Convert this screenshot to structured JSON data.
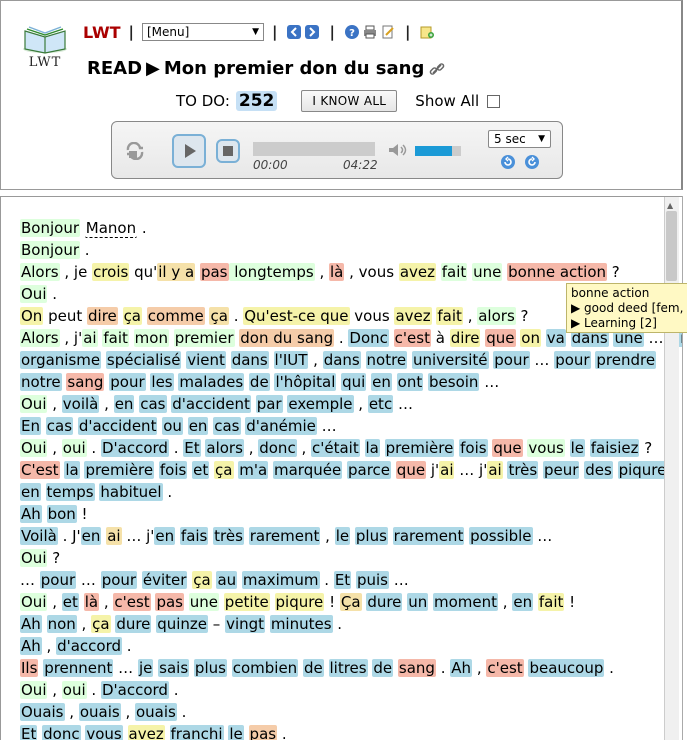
{
  "header": {
    "logo_text": "LWT",
    "brand": "LWT",
    "menu_select": "[Menu]",
    "read_label": "READ",
    "arrow": "▶",
    "title": "Mon premier don du sang",
    "todo_label": "TO DO:",
    "todo_count": "252",
    "know_all_label": "I KNOW ALL",
    "show_all_label": "Show All",
    "icons": [
      "prev-text-icon",
      "next-text-icon",
      "help-icon",
      "print-icon",
      "edit-text-icon",
      "new-term-icon",
      "link-icon"
    ]
  },
  "player": {
    "time_current": "00:00",
    "time_total": "04:22",
    "skip_select": "5 sec",
    "volume_level": 0.8,
    "progress_level": 0
  },
  "tooltip": {
    "line1": "bonne action",
    "line2": "▶ good deed [fem,",
    "line3": "▶ Learning [2]"
  },
  "colors": {
    "status1": "#f5b8a9",
    "status2": "#f5cca9",
    "status3": "#f5e1a9",
    "status4": "#f5f3a9",
    "status5": "#ddffdd",
    "unknown": "#add8e6",
    "brand": "#aa0000"
  },
  "text": {
    "lines": [
      [
        [
          "Bonjour",
          "s5"
        ],
        [
          " "
        ],
        [
          "Manon",
          "ign"
        ],
        [
          " ."
        ]
      ],
      [
        [
          "Bonjour",
          "s5"
        ],
        [
          " ."
        ]
      ],
      [
        [
          "Alors",
          "s5"
        ],
        [
          " , je "
        ],
        [
          "crois",
          "s4"
        ],
        [
          " qu'"
        ],
        [
          "il y a",
          "s3"
        ],
        [
          " "
        ],
        [
          "pas",
          "s1"
        ],
        [
          " longtemps",
          "s5"
        ],
        [
          " , "
        ],
        [
          "là",
          "s1"
        ],
        [
          " , vous "
        ],
        [
          "avez",
          "s4"
        ],
        [
          " "
        ],
        [
          "fait",
          "s5"
        ],
        [
          " "
        ],
        [
          "une",
          "s5"
        ],
        [
          " "
        ],
        [
          "bonne action",
          "s1"
        ],
        [
          " ?"
        ]
      ],
      [
        [
          "Oui",
          "s5"
        ],
        [
          " ."
        ]
      ],
      [
        [
          "On",
          "s4"
        ],
        [
          " peut "
        ],
        [
          "dire",
          "s2"
        ],
        [
          " "
        ],
        [
          "ça",
          "s4"
        ],
        [
          " "
        ],
        [
          "comme",
          "s2"
        ],
        [
          " "
        ],
        [
          "ça",
          "s3"
        ],
        [
          " . "
        ],
        [
          "Qu'est-ce que",
          "s4"
        ],
        [
          " vous "
        ],
        [
          "avez",
          "s4"
        ],
        [
          " "
        ],
        [
          "fait",
          "s4"
        ],
        [
          " , "
        ],
        [
          "alors",
          "s5"
        ],
        [
          " ?"
        ]
      ],
      [
        [
          "Alors",
          "s5"
        ],
        [
          " , j'"
        ],
        [
          "ai",
          "s5"
        ],
        [
          " "
        ],
        [
          "fait",
          "s5"
        ],
        [
          " "
        ],
        [
          "mon",
          "s5"
        ],
        [
          " "
        ],
        [
          "premier",
          "s5"
        ],
        [
          " "
        ],
        [
          "don du sang",
          "s2"
        ],
        [
          " . "
        ],
        [
          "Donc",
          "un"
        ],
        [
          " "
        ],
        [
          "c'est",
          "s1"
        ],
        [
          " à "
        ],
        [
          "dire",
          "s4"
        ],
        [
          " "
        ],
        [
          "que",
          "s1"
        ],
        [
          " "
        ],
        [
          "on",
          "s4"
        ],
        [
          " "
        ],
        [
          "va",
          "un"
        ],
        [
          " "
        ],
        [
          "dans",
          "un"
        ],
        [
          " "
        ],
        [
          "une",
          "un"
        ],
        [
          " … "
        ],
        [
          "Un",
          "un"
        ]
      ],
      [
        [
          "organisme",
          "un"
        ],
        [
          " "
        ],
        [
          "spécialisé",
          "un"
        ],
        [
          " "
        ],
        [
          "vient",
          "un"
        ],
        [
          " "
        ],
        [
          "dans",
          "un"
        ],
        [
          " "
        ],
        [
          "l'IUT",
          "un"
        ],
        [
          " , "
        ],
        [
          "dans",
          "un"
        ],
        [
          " "
        ],
        [
          "notre",
          "un"
        ],
        [
          " "
        ],
        [
          "université",
          "un"
        ],
        [
          " "
        ],
        [
          "pour",
          "un"
        ],
        [
          " … "
        ],
        [
          "pour",
          "un"
        ],
        [
          " "
        ],
        [
          "prendre",
          "un"
        ]
      ],
      [
        [
          "notre",
          "un"
        ],
        [
          " "
        ],
        [
          "sang",
          "s1"
        ],
        [
          " "
        ],
        [
          "pour",
          "un"
        ],
        [
          " "
        ],
        [
          "les",
          "un"
        ],
        [
          " "
        ],
        [
          "malades",
          "un"
        ],
        [
          " "
        ],
        [
          "de",
          "un"
        ],
        [
          " "
        ],
        [
          "l'hôpital",
          "un"
        ],
        [
          " "
        ],
        [
          "qui",
          "un"
        ],
        [
          " "
        ],
        [
          "en",
          "un"
        ],
        [
          " "
        ],
        [
          "ont",
          "un"
        ],
        [
          " "
        ],
        [
          "besoin",
          "un"
        ],
        [
          " …"
        ]
      ],
      [
        [
          "Oui",
          "s5"
        ],
        [
          " , "
        ],
        [
          "voilà",
          "un"
        ],
        [
          " , "
        ],
        [
          "en",
          "un"
        ],
        [
          " "
        ],
        [
          "cas",
          "un"
        ],
        [
          " "
        ],
        [
          "d'accident",
          "un"
        ],
        [
          " "
        ],
        [
          "par",
          "un"
        ],
        [
          " "
        ],
        [
          "exemple",
          "un"
        ],
        [
          " , "
        ],
        [
          "etc",
          "un"
        ],
        [
          " …"
        ]
      ],
      [
        [
          "En",
          "un"
        ],
        [
          " "
        ],
        [
          "cas",
          "un"
        ],
        [
          " "
        ],
        [
          "d'accident",
          "un"
        ],
        [
          " "
        ],
        [
          "ou",
          "un"
        ],
        [
          " "
        ],
        [
          "en",
          "un"
        ],
        [
          " "
        ],
        [
          "cas",
          "un"
        ],
        [
          " "
        ],
        [
          "d'anémie",
          "un"
        ],
        [
          " …"
        ]
      ],
      [
        [
          "Oui",
          "s5"
        ],
        [
          " , "
        ],
        [
          "oui",
          "s5"
        ],
        [
          " . "
        ],
        [
          "D'accord",
          "un"
        ],
        [
          " . "
        ],
        [
          "Et",
          "un"
        ],
        [
          " "
        ],
        [
          "alors",
          "un"
        ],
        [
          " , "
        ],
        [
          "donc",
          "un"
        ],
        [
          " , "
        ],
        [
          "c'était",
          "un"
        ],
        [
          " "
        ],
        [
          "la",
          "un"
        ],
        [
          " "
        ],
        [
          "première",
          "un"
        ],
        [
          " "
        ],
        [
          "fois",
          "un"
        ],
        [
          " "
        ],
        [
          "que",
          "s1"
        ],
        [
          " "
        ],
        [
          "vous",
          "s5"
        ],
        [
          " "
        ],
        [
          "le",
          "un"
        ],
        [
          " "
        ],
        [
          "faisiez",
          "un"
        ],
        [
          " ?"
        ]
      ],
      [
        [
          "C'est",
          "s1"
        ],
        [
          " "
        ],
        [
          "la",
          "un"
        ],
        [
          " "
        ],
        [
          "première",
          "un"
        ],
        [
          " "
        ],
        [
          "fois",
          "un"
        ],
        [
          " "
        ],
        [
          "et",
          "un"
        ],
        [
          " "
        ],
        [
          "ça",
          "s4"
        ],
        [
          " "
        ],
        [
          "m'a",
          "un"
        ],
        [
          " "
        ],
        [
          "marquée",
          "un"
        ],
        [
          " "
        ],
        [
          "parce",
          "un"
        ],
        [
          " "
        ],
        [
          "que",
          "s1"
        ],
        [
          " j'"
        ],
        [
          "ai",
          "s4"
        ],
        [
          " … j'"
        ],
        [
          "ai",
          "s4"
        ],
        [
          " "
        ],
        [
          "très",
          "un"
        ],
        [
          " "
        ],
        [
          "peur",
          "un"
        ],
        [
          " "
        ],
        [
          "des",
          "un"
        ],
        [
          " "
        ],
        [
          "piqures",
          "un"
        ]
      ],
      [
        [
          "en",
          "un"
        ],
        [
          " "
        ],
        [
          "temps",
          "un"
        ],
        [
          " "
        ],
        [
          "habituel",
          "un"
        ],
        [
          " ."
        ]
      ],
      [
        [
          "Ah",
          "un"
        ],
        [
          " "
        ],
        [
          "bon",
          "un"
        ],
        [
          " !"
        ]
      ],
      [
        [
          "Voilà",
          "un"
        ],
        [
          " . J'"
        ],
        [
          "en",
          "un"
        ],
        [
          " "
        ],
        [
          "ai",
          "s3"
        ],
        [
          " … j'"
        ],
        [
          "en",
          "un"
        ],
        [
          " "
        ],
        [
          "fais",
          "un"
        ],
        [
          " "
        ],
        [
          "très",
          "un"
        ],
        [
          " "
        ],
        [
          "rarement",
          "un"
        ],
        [
          " , "
        ],
        [
          "le",
          "un"
        ],
        [
          " "
        ],
        [
          "plus",
          "un"
        ],
        [
          " "
        ],
        [
          "rarement",
          "un"
        ],
        [
          " "
        ],
        [
          "possible",
          "un"
        ],
        [
          " …"
        ]
      ],
      [
        [
          "Oui",
          "s5"
        ],
        [
          " ?"
        ]
      ],
      [
        [
          " … "
        ],
        [
          "pour",
          "un"
        ],
        [
          " … "
        ],
        [
          "pour",
          "un"
        ],
        [
          " "
        ],
        [
          "éviter",
          "un"
        ],
        [
          " "
        ],
        [
          "ça",
          "s4"
        ],
        [
          " "
        ],
        [
          "au",
          "un"
        ],
        [
          " "
        ],
        [
          "maximum",
          "un"
        ],
        [
          " . "
        ],
        [
          "Et",
          "un"
        ],
        [
          " "
        ],
        [
          "puis",
          "un"
        ],
        [
          " …"
        ]
      ],
      [
        [
          "Oui",
          "s5"
        ],
        [
          " , "
        ],
        [
          "et",
          "un"
        ],
        [
          " "
        ],
        [
          "là",
          "s1"
        ],
        [
          " , "
        ],
        [
          "c'est",
          "s1"
        ],
        [
          " "
        ],
        [
          "pas",
          "s1"
        ],
        [
          " "
        ],
        [
          "une",
          "s5"
        ],
        [
          " "
        ],
        [
          "petite",
          "s4"
        ],
        [
          " "
        ],
        [
          "piqure",
          "s4"
        ],
        [
          " ! "
        ],
        [
          "Ça",
          "s3"
        ],
        [
          " "
        ],
        [
          "dure",
          "un"
        ],
        [
          " "
        ],
        [
          "un",
          "un"
        ],
        [
          " "
        ],
        [
          "moment",
          "un"
        ],
        [
          " , "
        ],
        [
          "en",
          "un"
        ],
        [
          " "
        ],
        [
          "fait",
          "s4"
        ],
        [
          " !"
        ]
      ],
      [
        [
          "Ah",
          "un"
        ],
        [
          " "
        ],
        [
          "non",
          "un"
        ],
        [
          " , "
        ],
        [
          "ça",
          "s4"
        ],
        [
          " "
        ],
        [
          "dure",
          "un"
        ],
        [
          " "
        ],
        [
          "quinze",
          "un"
        ],
        [
          " – "
        ],
        [
          "vingt",
          "un"
        ],
        [
          " "
        ],
        [
          "minutes",
          "un"
        ],
        [
          " ."
        ]
      ],
      [
        [
          "Ah",
          "un"
        ],
        [
          " , "
        ],
        [
          "d'accord",
          "un"
        ],
        [
          " ."
        ]
      ],
      [
        [
          "Ils",
          "s1"
        ],
        [
          " "
        ],
        [
          "prennent",
          "un"
        ],
        [
          " … "
        ],
        [
          "je",
          "un"
        ],
        [
          " "
        ],
        [
          "sais",
          "un"
        ],
        [
          " "
        ],
        [
          "plus",
          "un"
        ],
        [
          " "
        ],
        [
          "combien",
          "un"
        ],
        [
          " "
        ],
        [
          "de",
          "un"
        ],
        [
          " "
        ],
        [
          "litres",
          "un"
        ],
        [
          " "
        ],
        [
          "de",
          "un"
        ],
        [
          " "
        ],
        [
          "sang",
          "s1"
        ],
        [
          " . "
        ],
        [
          "Ah",
          "un"
        ],
        [
          " , "
        ],
        [
          "c'est",
          "s1"
        ],
        [
          " "
        ],
        [
          "beaucoup",
          "un"
        ],
        [
          " ."
        ]
      ],
      [
        [
          "Oui",
          "s5"
        ],
        [
          " , "
        ],
        [
          "oui",
          "s5"
        ],
        [
          " . "
        ],
        [
          "D'accord",
          "un"
        ],
        [
          " ."
        ]
      ],
      [
        [
          "Ouais",
          "un"
        ],
        [
          " , "
        ],
        [
          "ouais",
          "un"
        ],
        [
          " , "
        ],
        [
          "ouais",
          "un"
        ],
        [
          " ."
        ]
      ],
      [
        [
          "Et",
          "un"
        ],
        [
          " "
        ],
        [
          "donc",
          "un"
        ],
        [
          " "
        ],
        [
          "vous",
          "un"
        ],
        [
          " "
        ],
        [
          "avez",
          "s4"
        ],
        [
          " "
        ],
        [
          "franchi",
          "un"
        ],
        [
          " "
        ],
        [
          "le",
          "un"
        ],
        [
          " "
        ],
        [
          "pas",
          "s2"
        ],
        [
          " ."
        ]
      ]
    ]
  }
}
